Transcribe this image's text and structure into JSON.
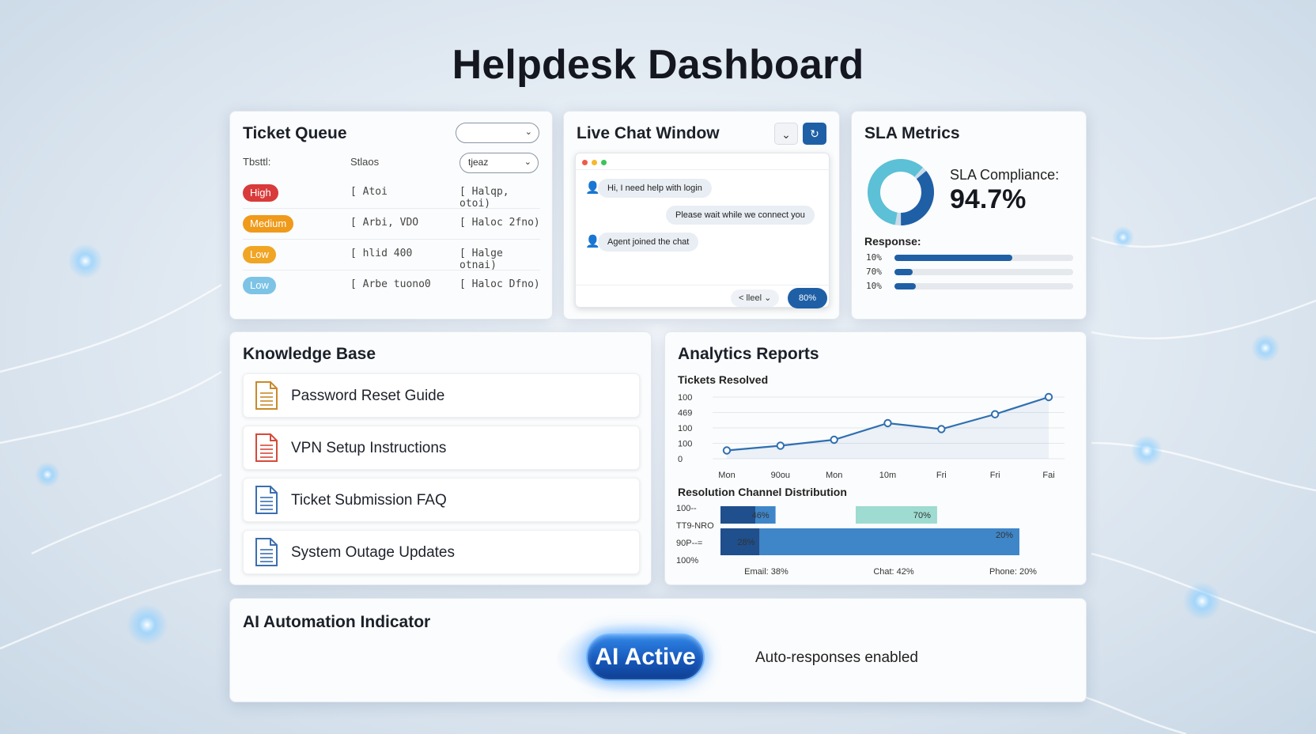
{
  "page": {
    "title": "Helpdesk Dashboard"
  },
  "ticket_queue": {
    "title": "Ticket Queue",
    "filter_value": "",
    "header_col1": "Tbsttl:",
    "header_col2": "Stlaos",
    "header_select": "tjeaz",
    "rows": [
      {
        "priority": "High",
        "color": "#d93a3a",
        "status": "[ Atoi",
        "assignee": "[ Halqp, otoi)"
      },
      {
        "priority": "Medium",
        "color": "#ef9a1a",
        "status": "[ Arbi, VDO",
        "assignee": "[ Haloc 2fno)"
      },
      {
        "priority": "Low",
        "color": "#f1a524",
        "status": "[ hlid 400",
        "assignee": "[ Halge otnai)"
      },
      {
        "priority": "Low",
        "color": "#7cc3e6",
        "status": "[ Arbe tuono0",
        "assignee": "[ Haloc Dfno)"
      }
    ]
  },
  "live_chat": {
    "title": "Live Chat Window",
    "messages": [
      {
        "text": "Hi, I need help with login",
        "from": "user"
      },
      {
        "text": "Please wait while we connect you",
        "from": "system"
      },
      {
        "text": "Agent joined the chat",
        "from": "agent"
      }
    ],
    "footer_select": "< lleel",
    "send_label": "80%",
    "icons": [
      "chevron-down-icon",
      "refresh-icon",
      "user-icon"
    ]
  },
  "sla": {
    "title": "SLA Metrics",
    "compliance_label": "SLA Compliance:",
    "compliance_value": "94.7%",
    "compliance_fraction": 0.947,
    "response_label": "Response:",
    "response_rows": [
      {
        "label": "10%",
        "fill": 0.66
      },
      {
        "label": "70%",
        "fill": 0.1
      },
      {
        "label": "10%",
        "fill": 0.12
      }
    ],
    "colors": {
      "donut_main": "#1f5fa6",
      "donut_accent": "#5cc0d6",
      "donut_track": "#c8dbe8"
    }
  },
  "knowledge_base": {
    "title": "Knowledge Base",
    "items": [
      {
        "label": "Password Reset Guide",
        "icon": "document-icon",
        "color": "#c98a2b"
      },
      {
        "label": "VPN Setup Instructions",
        "icon": "document-icon",
        "color": "#d64a3a"
      },
      {
        "label": "Ticket Submission FAQ",
        "icon": "document-icon",
        "color": "#3b6fb0"
      },
      {
        "label": "System Outage Updates",
        "icon": "document-icon",
        "color": "#3b6fb0"
      }
    ]
  },
  "analytics": {
    "title": "Analytics Reports",
    "line_title": "Tickets Resolved",
    "bar_title": "Resolution Channel Distribution"
  },
  "chart_data": [
    {
      "type": "line",
      "title": "Tickets Resolved",
      "categories": [
        "Mon",
        "90ou",
        "Mon",
        "10m",
        "Fri",
        "Fri",
        "Fai"
      ],
      "y_tick_labels": [
        "100",
        "469",
        "100",
        "100",
        "0"
      ],
      "values": [
        14,
        22,
        32,
        60,
        50,
        75,
        104
      ],
      "ylim": [
        0,
        104
      ],
      "grid": true
    },
    {
      "type": "bar",
      "title": "Resolution Channel Distribution",
      "y_tick_labels": [
        "100--",
        "TT9-NRO",
        "90P--=",
        "100%"
      ],
      "categories": [
        "Email: 38%",
        "Chat: 42%",
        "Phone: 20%"
      ],
      "series": [
        {
          "label": "46%",
          "value": 46
        },
        {
          "label": "70%",
          "value": 70
        },
        {
          "label": "28%",
          "value": 28
        },
        {
          "label": "20%",
          "value": 20
        }
      ]
    }
  ],
  "ai_automation": {
    "title": "AI Automation Indicator",
    "button_label": "AI Active",
    "status_text": "Auto-responses enabled"
  }
}
